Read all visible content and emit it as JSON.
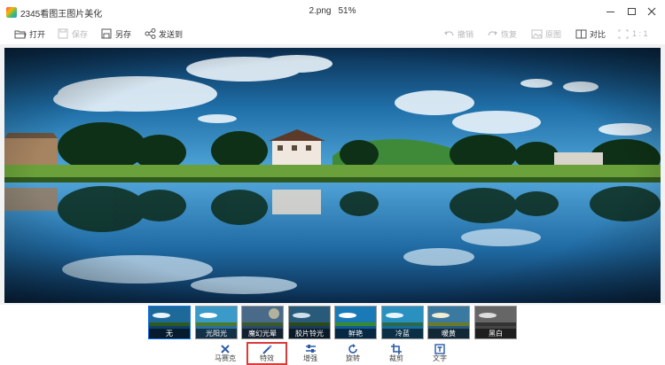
{
  "app": {
    "title": "2345看图王图片美化",
    "file_name": "2.png",
    "zoom": "51%"
  },
  "toolbar": {
    "open": "打开",
    "save": "保存",
    "save_as": "另存",
    "send_to_phone": "发送到",
    "undo": "撤销",
    "redo": "恢复",
    "original": "原图",
    "compare": "对比",
    "actual_size": "1 : 1"
  },
  "filters": [
    {
      "label": "无",
      "tint": "#1d6a9a"
    },
    {
      "label": "光阳光",
      "tint": "#3a9ac8"
    },
    {
      "label": "魔幻光晕",
      "tint": "#4a6a8a"
    },
    {
      "label": "胶片铃光",
      "tint": "#2a5a7a"
    },
    {
      "label": "鲜艳",
      "tint": "#1a7ab8"
    },
    {
      "label": "冷蓝",
      "tint": "#2a90c0"
    },
    {
      "label": "暖黄",
      "tint": "#3a7aa0"
    },
    {
      "label": "黑白",
      "tint": "#666666"
    }
  ],
  "selected_filter": "无",
  "bottom_tabs": [
    {
      "label": "马赛克",
      "icon": "mosaic-icon"
    },
    {
      "label": "特效",
      "icon": "magic-wand-icon",
      "active": true
    },
    {
      "label": "增强",
      "icon": "sliders-icon"
    },
    {
      "label": "旋转",
      "icon": "rotate-icon"
    },
    {
      "label": "裁剪",
      "icon": "crop-icon"
    },
    {
      "label": "文字",
      "icon": "text-icon"
    }
  ],
  "colors": {
    "accent_blue": "#1a73e8",
    "active_outline": "#d93a3a",
    "disabled_text": "#b8b8b8"
  }
}
